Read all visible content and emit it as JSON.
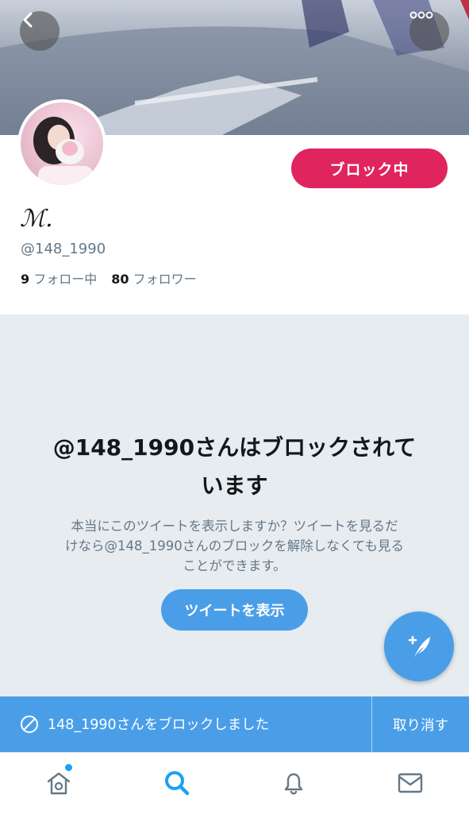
{
  "header": {
    "back_icon": "chevron-left-icon",
    "more_icon": "more-dots-icon"
  },
  "profile": {
    "display_name": "ℳ.",
    "handle": "@148_1990",
    "block_button_label": "ブロック中",
    "following_count": "9",
    "following_label": "フォロー中",
    "followers_count": "80",
    "followers_label": "フォロワー"
  },
  "blocked_notice": {
    "title_line1": "@148_1990さんはブロックされて",
    "title_line2": "います",
    "description_line1": "本当にこのツイートを表示しますか？ツイートを見るだ",
    "description_line2": "けなら@148_1990さんのブロックを解除しなくても見る",
    "description_line3": "ことができます。",
    "show_button_label": "ツイートを表示"
  },
  "compose": {
    "icon": "compose-tweet-icon"
  },
  "toast": {
    "icon": "block-icon",
    "message": "148_1990さんをブロックしました",
    "undo_label": "取り消す"
  },
  "tabbar": {
    "items": [
      {
        "icon": "home-icon",
        "has_badge": true
      },
      {
        "icon": "search-icon",
        "active": true
      },
      {
        "icon": "bell-icon"
      },
      {
        "icon": "mail-icon"
      }
    ]
  },
  "colors": {
    "block_red": "#e0245e",
    "accent_blue": "#4a9ee8",
    "gray_bg": "#e6ecf0",
    "text_secondary": "#657786"
  }
}
